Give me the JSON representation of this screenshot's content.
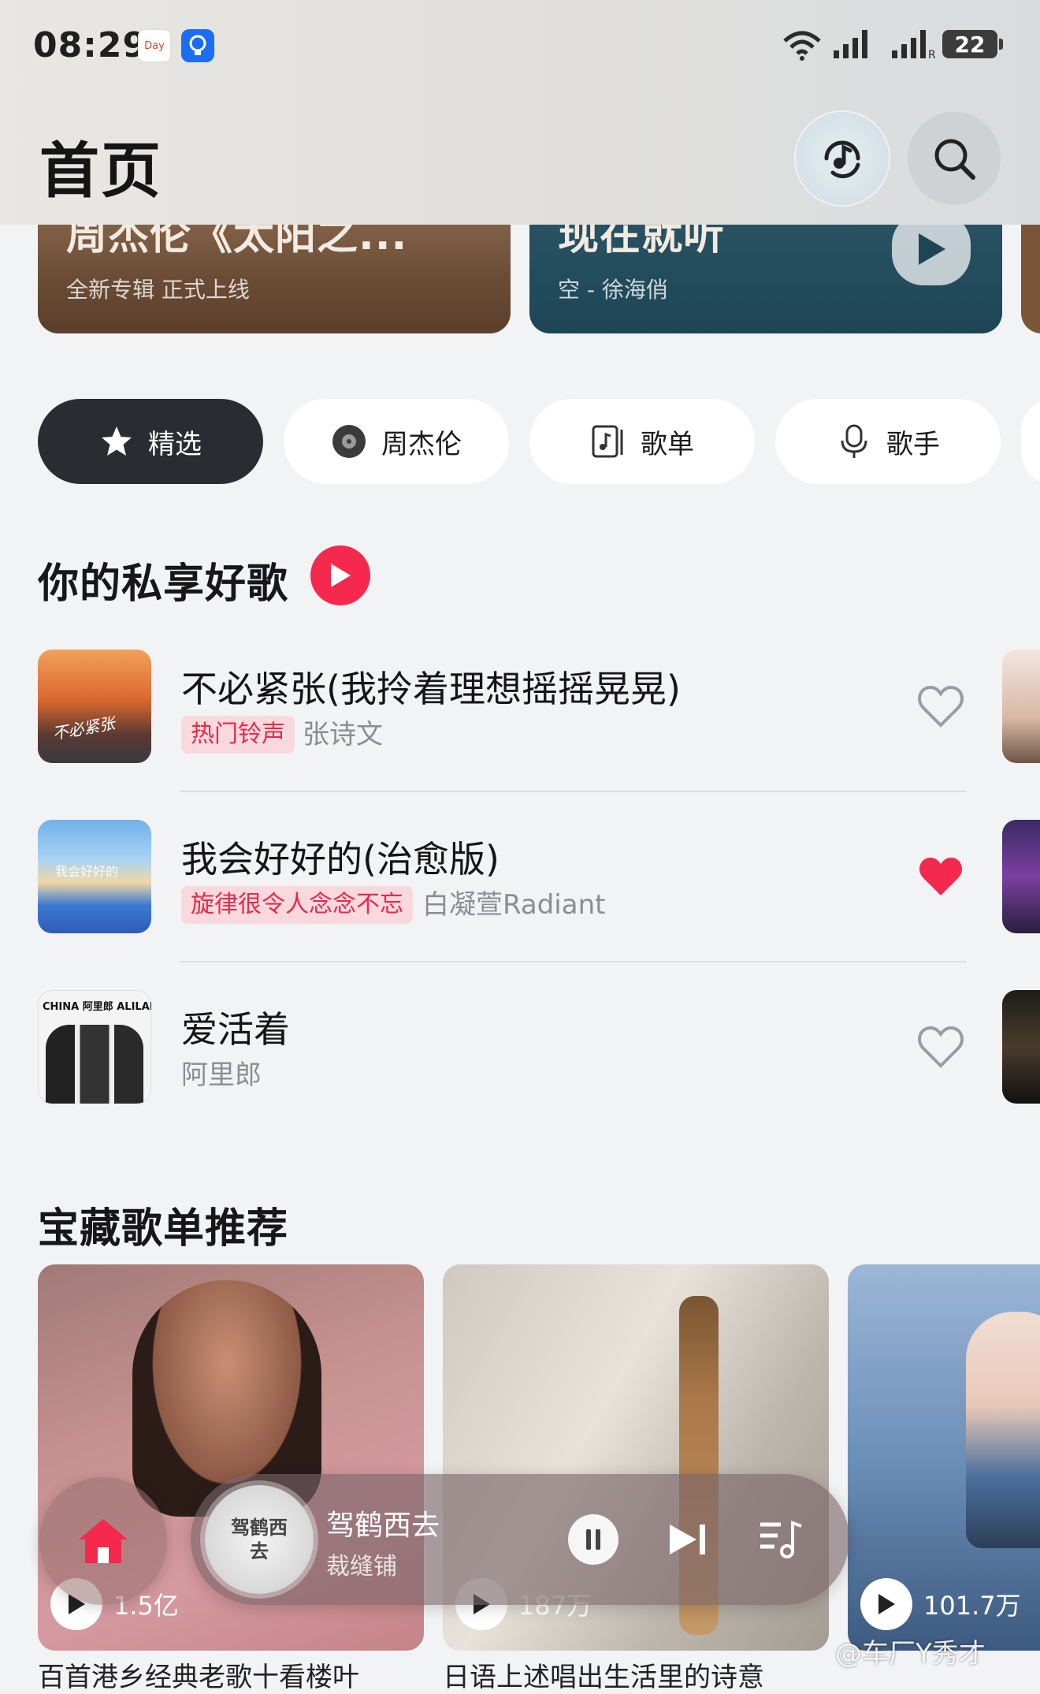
{
  "status_bar": {
    "time": "08:29",
    "day_icon_text": "Day",
    "battery": "22"
  },
  "header": {
    "title": "首页"
  },
  "banners": [
    {
      "title": "周杰伦《太阳之...",
      "subtitle": "全新专辑 正式上线"
    },
    {
      "title": "现在就听",
      "subtitle": "空 - 徐海俏"
    }
  ],
  "chips": [
    {
      "label": "精选",
      "icon": "star-icon",
      "active": true
    },
    {
      "label": "周杰伦",
      "icon": "vinyl-icon",
      "active": false
    },
    {
      "label": "歌单",
      "icon": "playlist-icon",
      "active": false
    },
    {
      "label": "歌手",
      "icon": "microphone-icon",
      "active": false
    }
  ],
  "private_songs": {
    "title": "你的私享好歌",
    "items": [
      {
        "title": "不必紧张(我拎着理想摇摇晃晃)",
        "tag": "热门铃声",
        "artist": "张诗文",
        "liked": false,
        "cover_text": "不必紧张"
      },
      {
        "title": "我会好好的(治愈版)",
        "tag": "旋律很令人念念不忘",
        "artist": "白凝萱Radiant",
        "liked": true,
        "cover_text": "我会好好的"
      },
      {
        "title": "爱活着",
        "tag": "",
        "artist": "阿里郎",
        "liked": false,
        "cover_text": "CHINA 阿里郎 ALILANG"
      }
    ]
  },
  "playlists": {
    "title": "宝藏歌单推荐",
    "items": [
      {
        "play_count": "1.5亿",
        "caption": "百首港乡经典老歌十看楼叶"
      },
      {
        "play_count": "187万",
        "caption": "日语上述唱出生活里的诗意"
      },
      {
        "play_count": "101.7万",
        "caption": ""
      }
    ]
  },
  "mini_player": {
    "title": "驾鹤西去",
    "artist": "裁缝铺",
    "disc_text": "驾鹤西去"
  },
  "watermark": "@车厂Y秀才",
  "colors": {
    "accent": "#f5294e",
    "chip_active": "#2a2c31",
    "tag_bg": "#f9d9de"
  }
}
